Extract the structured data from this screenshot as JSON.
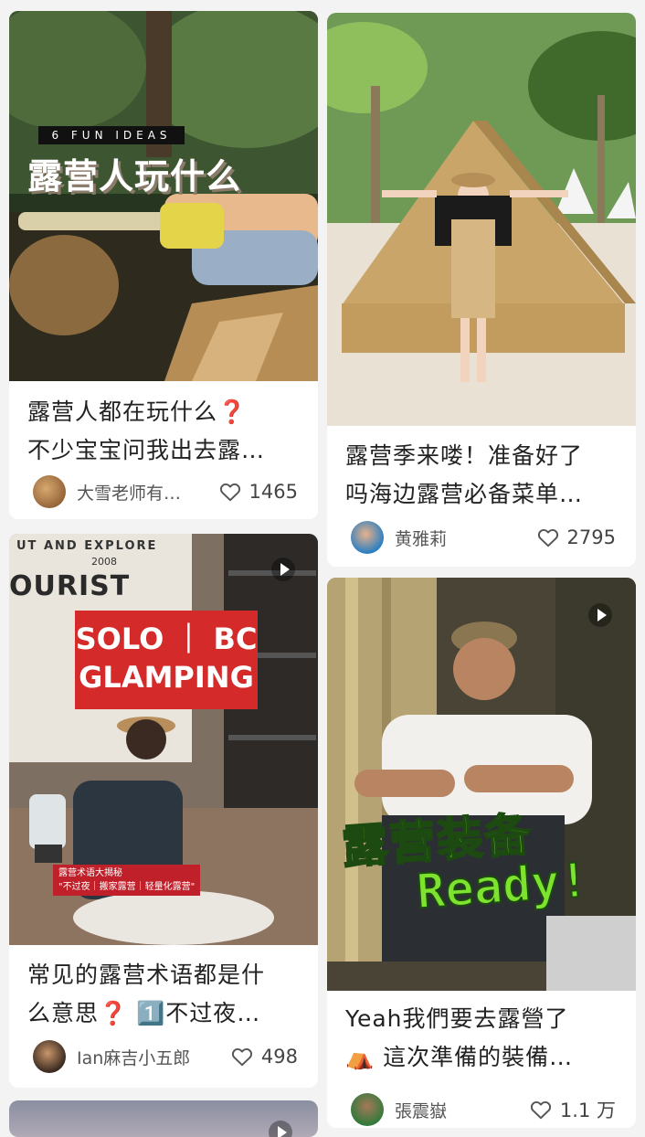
{
  "feed": {
    "cards": [
      {
        "cover_tag": "6 FUN IDEAS",
        "cover_heading": "露营人玩什么",
        "title": "露营人都在玩什么❓\n不少宝宝问我出去露…",
        "author": "大雪老师有…",
        "likes": "1465"
      },
      {
        "title": "露营季来喽！准备好了\n吗海边露营必备菜单…",
        "author": "黄雅莉",
        "likes": "2795"
      },
      {
        "cover_sign": "UT AND EXPLORE",
        "cover_sign_big": "OURIST",
        "cover_sign_year": "2008",
        "cover_label": "SOLO ｜ BC\nGLAMPING",
        "cover_caption": "露营术语大揭秘\n\"不过夜｜搬家露营｜轻量化露营\"",
        "title": "常见的露营术语都是什\n么意思❓ 1️⃣不过夜…",
        "author": "Ian麻吉小五郎",
        "likes": "498"
      },
      {
        "cover_line1": "露营装备",
        "cover_line2": "Ready!",
        "title": "Yeah我們要去露營了\n⛺ 這次準備的裝備…",
        "author": "張震嶽",
        "likes": "1.1 万"
      }
    ]
  }
}
